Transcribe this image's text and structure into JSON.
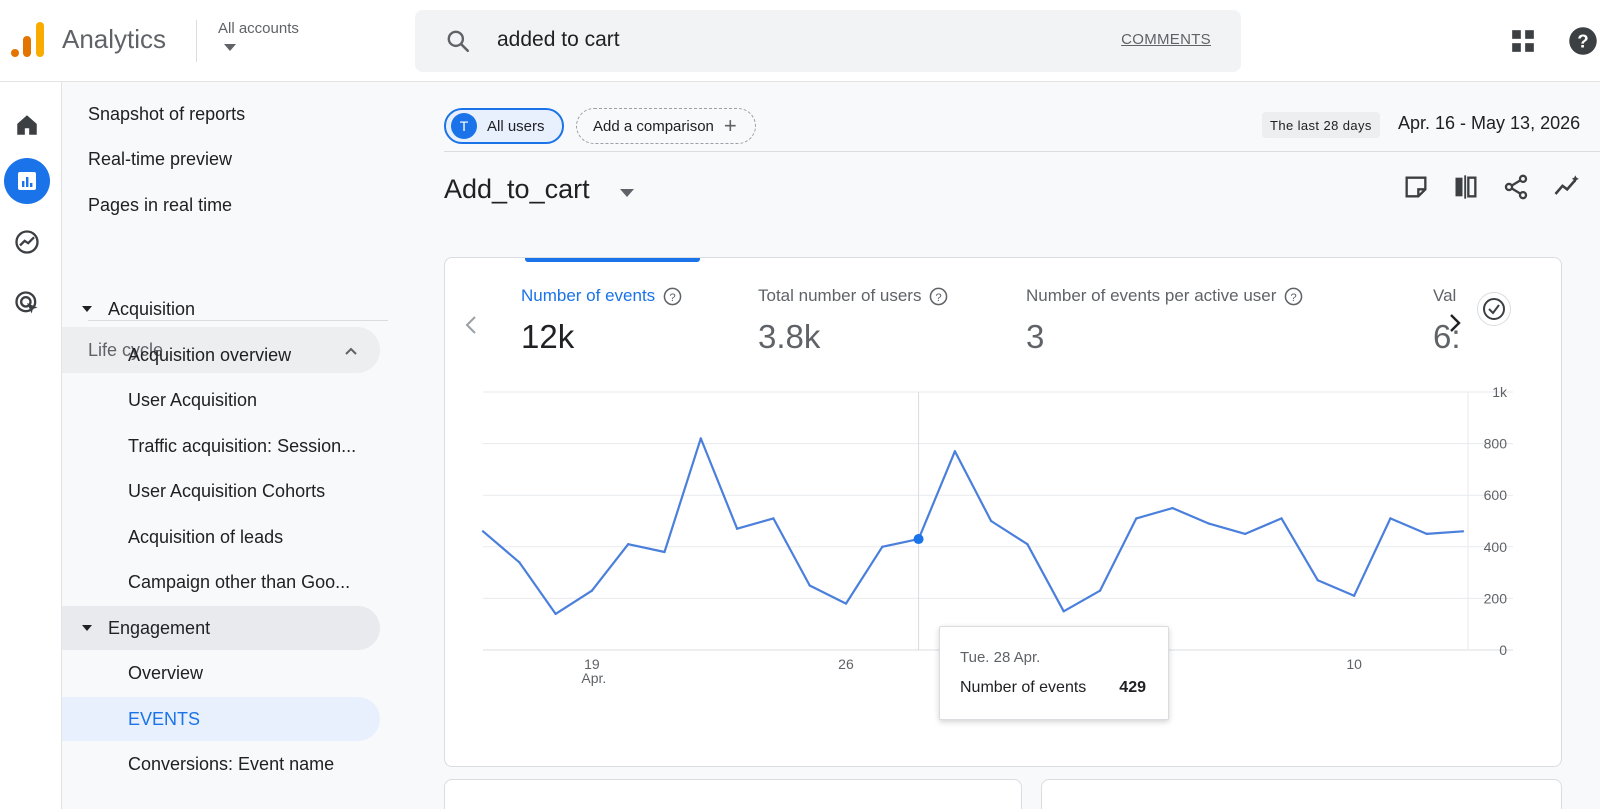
{
  "header": {
    "app_title": "Analytics",
    "account_label": "All accounts",
    "search_query": "added to cart",
    "search_link": "COMMENTS"
  },
  "rail": [
    {
      "icon": "home-icon"
    },
    {
      "icon": "reports-icon",
      "active": true
    },
    {
      "icon": "explore-icon"
    },
    {
      "icon": "advertising-icon"
    }
  ],
  "sidebar": {
    "top_items": [
      "Snapshot of reports",
      "Real-time preview",
      "Pages in real time"
    ],
    "section": "Life cycle",
    "acquisition": {
      "label": "Acquisition",
      "items": [
        "Acquisition overview",
        "User Acquisition",
        "Traffic acquisition: Session...",
        "User Acquisition Cohorts",
        "Acquisition of leads",
        "Campaign other than Goo..."
      ]
    },
    "engagement": {
      "label": "Engagement",
      "items": [
        "Overview",
        "EVENTS",
        "Conversions: Event name"
      ]
    }
  },
  "main": {
    "comparison": {
      "users_initial": "T",
      "users_label": "All users",
      "add_label": "Add a comparison"
    },
    "date_badge": "The last 28 days",
    "date_range": "Apr. 16 - May 13, 2026",
    "title": "Add_to_cart",
    "metrics": [
      {
        "label": "Number of events",
        "value": "12k"
      },
      {
        "label": "Total number of users",
        "value": "3.8k"
      },
      {
        "label": "Number of events per active user",
        "value": "3"
      },
      {
        "label": "Val",
        "value": "6:"
      }
    ],
    "tooltip": {
      "date": "Tue. 28 Apr.",
      "metric": "Number of events",
      "value": "429"
    }
  },
  "colors": {
    "accent": "#1a73e8",
    "line": "#4a7fdc"
  },
  "chart_data": {
    "type": "line",
    "series": [
      {
        "values": [
          460,
          340,
          140,
          230,
          410,
          380,
          820,
          470,
          510,
          250,
          180,
          400,
          430,
          770,
          500,
          410,
          150,
          230,
          510,
          550,
          490,
          450,
          510,
          270,
          210,
          510,
          450,
          460
        ]
      }
    ],
    "x_ticks": [
      {
        "index": 3,
        "label": "19",
        "sub": "Apr."
      },
      {
        "index": 10,
        "label": "26",
        "sub": ""
      },
      {
        "index": 24,
        "label": "10",
        "sub": ""
      }
    ],
    "y_ticks": [
      "0",
      "200",
      "400",
      "600",
      "800",
      "1k"
    ],
    "ylim": [
      0,
      1000
    ],
    "highlight_index": 12
  }
}
